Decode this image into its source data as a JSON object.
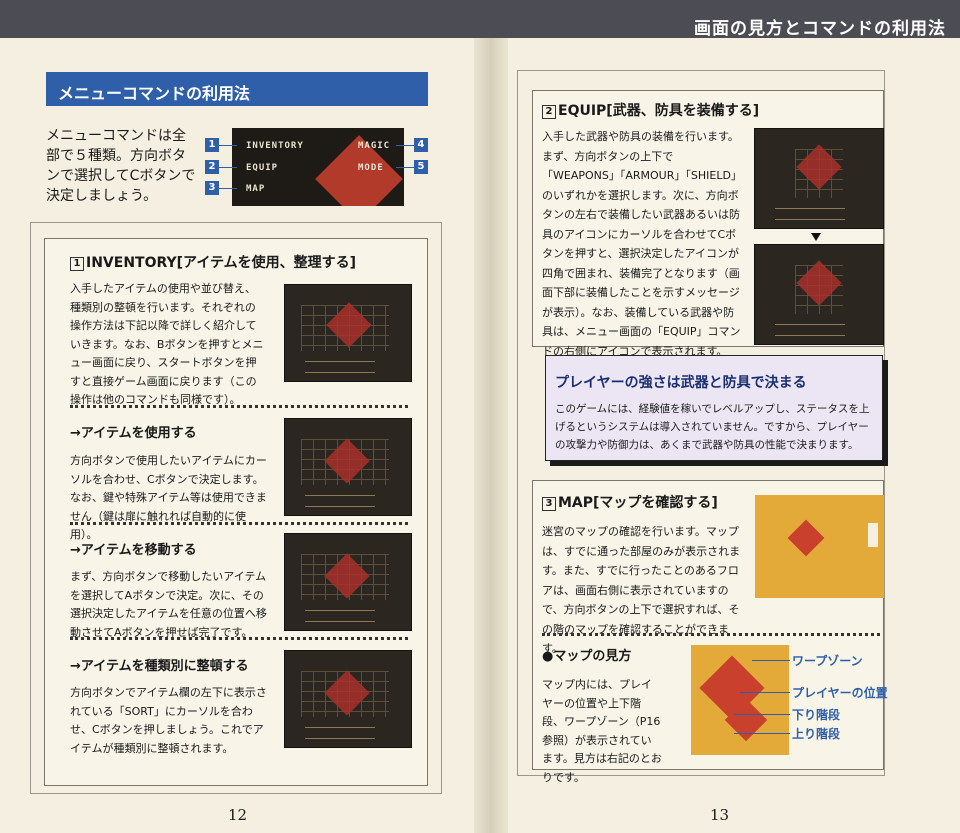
{
  "header": {
    "title": "画面の見方とコマンドの利用法"
  },
  "menu": {
    "banner": "メニューコマンドの利用法",
    "intro": "メニューコマンドは全部で５種類。方向ボタンで選択してCボタンで決定しましょう。",
    "options": [
      {
        "num": "1",
        "label": "INVENTORY"
      },
      {
        "num": "2",
        "label": "EQUIP"
      },
      {
        "num": "3",
        "label": "MAP"
      },
      {
        "num": "4",
        "label": "MAGIC"
      },
      {
        "num": "5",
        "label": "MODE"
      }
    ]
  },
  "inventory": {
    "num": "1",
    "title": "INVENTORY[アイテムを使用、整理する]",
    "body": "入手したアイテムの使用や並び替え、種類別の整頓を行います。それぞれの操作方法は下記以降で詳しく紹介していきます。なお、Bボタンを押すとメニュー画面に戻り、スタートボタンを押すと直接ゲーム画面に戻ります（この操作は他のコマンドも同様です）。",
    "use_title": "→アイテムを使用する",
    "use_body": "方向ボタンで使用したいアイテムにカーソルを合わせ、Cボタンで決定します。なお、鍵や特殊アイテム等は使用できません（鍵は扉に触れれば自動的に使用）。",
    "move_title": "→アイテムを移動する",
    "move_body": "まず、方向ボタンで移動したいアイテムを選択してAボタンで決定。次に、その選択決定したアイテムを任意の位置へ移動させてAボタンを押せば完了です。",
    "sort_title": "→アイテムを種類別に整頓する",
    "sort_body": "方向ボタンでアイテム欄の左下に表示されている「SORT」にカーソルを合わせ、Cボタンを押しましょう。これでアイテムが種類別に整頓されます。"
  },
  "equip": {
    "num": "2",
    "title": "EQUIP[武器、防具を装備する]",
    "body": "入手した武器や防具の装備を行います。まず、方向ボタンの上下で「WEAPONS」「ARMOUR」「SHIELD」のいずれかを選択します。次に、方向ボタンの左右で装備したい武器あるいは防具のアイコンにカーソルを合わせてCボタンを押すと、選択決定したアイコンが四角で囲まれ、装備完了となります（画面下部に装備したことを示すメッセージが表示）。なお、装備している武器や防具は、メニュー画面の「EQUIP」コマンドの右側にアイコンで表示されます。"
  },
  "strength": {
    "title": "プレイヤーの強さは武器と防具で決まる",
    "body": "このゲームには、経験値を稼いでレベルアップし、ステータスを上げるというシステムは導入されていません。ですから、プレイヤーの攻撃力や防御力は、あくまで武器や防具の性能で決まります。"
  },
  "map": {
    "num": "3",
    "title": "MAP[マップを確認する]",
    "body": "迷宮のマップの確認を行います。マップは、すでに通った部屋のみが表示されます。また、すでに行ったことのあるフロアは、画面右側に表示されていますので、方向ボタンの上下で選択すれば、その階のマップを確認することができます。",
    "view_title": "●マップの見方",
    "view_body": "マップ内には、プレイヤーの位置や上下階段、ワープゾーン（P16参照）が表示されています。見方は右記のとおりです。",
    "legend": [
      "ワープゾーン",
      "プレイヤーの位置",
      "下り階段",
      "上り階段"
    ]
  },
  "pages": {
    "left": "12",
    "right": "13"
  },
  "colors": {
    "accent": "#2f5fa8",
    "band": "#4c4c54",
    "map": "#e3aa3a",
    "dungeon": "#a8302a"
  }
}
